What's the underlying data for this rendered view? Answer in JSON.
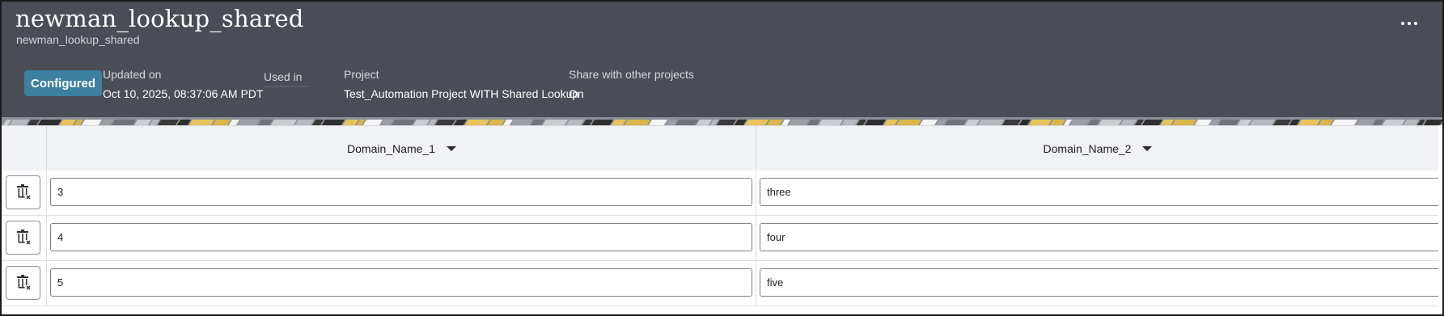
{
  "header": {
    "title": "newman_lookup_shared",
    "subtitle": "newman_lookup_shared",
    "status_badge": "Configured",
    "updated_label": "Updated on",
    "updated_value": "Oct 10, 2025, 08:37:06 AM PDT",
    "used_in_label": "Used in",
    "project_label": "Project",
    "project_value": "Test_Automation Project WITH Shared Lookup",
    "share_label": "Share with other projects",
    "share_value": "On",
    "more_icon": "ellipsis-icon"
  },
  "table": {
    "columns": [
      {
        "label": "Domain_Name_1",
        "icon": "caret-down-icon"
      },
      {
        "label": "Domain_Name_2",
        "icon": "caret-down-icon"
      }
    ],
    "rows": [
      {
        "col1": "3",
        "col2": "three"
      },
      {
        "col1": "4",
        "col2": "four"
      },
      {
        "col1": "5",
        "col2": "five"
      }
    ],
    "row_action_icon": "delete-row-icon"
  },
  "colors": {
    "header_bg": "#4a4d55",
    "badge_bg": "#3d7fa0",
    "table_header_bg": "#f1f2f5"
  }
}
